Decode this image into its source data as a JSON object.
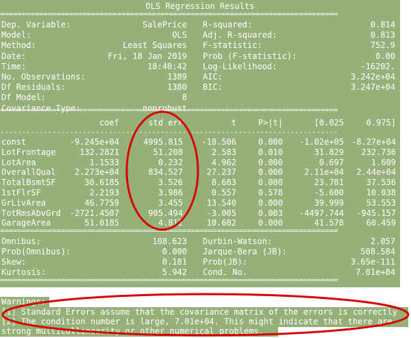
{
  "title": "OLS Regression Results",
  "summary": {
    "left": [
      {
        "label": "Dep. Variable:",
        "value": "SalePrice"
      },
      {
        "label": "Model:",
        "value": "OLS"
      },
      {
        "label": "Method:",
        "value": "Least Squares"
      },
      {
        "label": "Date:",
        "value": "Fri, 18 Jan 2019"
      },
      {
        "label": "Time:",
        "value": "18:40:42"
      },
      {
        "label": "No. Observations:",
        "value": "1389"
      },
      {
        "label": "Df Residuals:",
        "value": "1380"
      },
      {
        "label": "Df Model:",
        "value": "8"
      },
      {
        "label": "Covariance Type:",
        "value": "nonrobust"
      }
    ],
    "right": [
      {
        "label": "R-squared:",
        "value": "0.814"
      },
      {
        "label": "Adj. R-squared:",
        "value": "0.813"
      },
      {
        "label": "F-statistic:",
        "value": "752.9"
      },
      {
        "label": "Prob (F-statistic):",
        "value": "0.00"
      },
      {
        "label": "Log-Likelihood:",
        "value": "-16202."
      },
      {
        "label": "AIC:",
        "value": "3.242e+04"
      },
      {
        "label": "BIC:",
        "value": "3.247e+04"
      }
    ]
  },
  "coef_table": {
    "headers": [
      "coef",
      "std err",
      "t",
      "P>|t|",
      "[0.025",
      "0.975]"
    ],
    "rows": [
      [
        "const",
        "-9.245e+04",
        "4995.815",
        "-18.506",
        "0.000",
        "-1.02e+05",
        "-8.27e+04"
      ],
      [
        "LotFrontage",
        "132.2821",
        "51.208",
        "2.583",
        "0.010",
        "31.829",
        "232.736"
      ],
      [
        "LotArea",
        "1.1533",
        "0.232",
        "4.962",
        "0.000",
        "0.697",
        "1.609"
      ],
      [
        "OverallQual",
        "2.273e+04",
        "834.527",
        "27.237",
        "0.000",
        "2.11e+04",
        "2.44e+04"
      ],
      [
        "TotalBsmtSF",
        "30.6185",
        "3.526",
        "8.683",
        "0.000",
        "23.701",
        "37.536"
      ],
      [
        "1stFlrSF",
        "2.2193",
        "3.986",
        "0.557",
        "0.578",
        "-5.600",
        "10.038"
      ],
      [
        "GrLivArea",
        "46.7759",
        "3.455",
        "13.540",
        "0.000",
        "39.999",
        "53.553"
      ],
      [
        "TotRmsAbvGrd",
        "-2721.4507",
        "905.494",
        "-3.005",
        "0.003",
        "-4497.744",
        "-945.157"
      ],
      [
        "GarageArea",
        "51.0185",
        "4.812",
        "10.602",
        "0.000",
        "41.578",
        "60.459"
      ]
    ]
  },
  "diagnostics": {
    "left": [
      {
        "label": "Omnibus:",
        "value": "108.623"
      },
      {
        "label": "Prob(Omnibus):",
        "value": "0.000"
      },
      {
        "label": "Skew:",
        "value": "0.181"
      },
      {
        "label": "Kurtosis:",
        "value": "5.942"
      }
    ],
    "right": [
      {
        "label": "Durbin-Watson:",
        "value": "2.057"
      },
      {
        "label": "Jarque-Bera (JB):",
        "value": "508.584"
      },
      {
        "label": "Prob(JB):",
        "value": "3.65e-111"
      },
      {
        "label": "Cond. No.",
        "value": "7.01e+04"
      }
    ]
  },
  "warnings": {
    "heading": "Warnings:",
    "lines": [
      "[1] Standard Errors assume that the covariance matrix of the errors is correctly",
      "[2] The condition number is large, 7.01e+04. This might indicate that there are",
      "strong multicollinearity or other numerical problems."
    ]
  },
  "separator_chars": {
    "double": "==============================================================================",
    "single": "------------------------------------------------------------------------------"
  },
  "colors": {
    "highlight": "#96b07a",
    "text": "#ffffff",
    "annotation": "#d90000"
  }
}
